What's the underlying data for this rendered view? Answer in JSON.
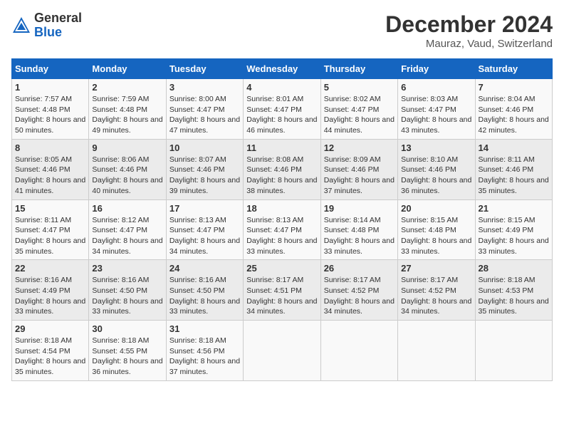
{
  "logo": {
    "text_general": "General",
    "text_blue": "Blue"
  },
  "title": "December 2024",
  "subtitle": "Mauraz, Vaud, Switzerland",
  "days_of_week": [
    "Sunday",
    "Monday",
    "Tuesday",
    "Wednesday",
    "Thursday",
    "Friday",
    "Saturday"
  ],
  "weeks": [
    [
      {
        "day": "1",
        "sunrise": "Sunrise: 7:57 AM",
        "sunset": "Sunset: 4:48 PM",
        "daylight": "Daylight: 8 hours and 50 minutes."
      },
      {
        "day": "2",
        "sunrise": "Sunrise: 7:59 AM",
        "sunset": "Sunset: 4:48 PM",
        "daylight": "Daylight: 8 hours and 49 minutes."
      },
      {
        "day": "3",
        "sunrise": "Sunrise: 8:00 AM",
        "sunset": "Sunset: 4:47 PM",
        "daylight": "Daylight: 8 hours and 47 minutes."
      },
      {
        "day": "4",
        "sunrise": "Sunrise: 8:01 AM",
        "sunset": "Sunset: 4:47 PM",
        "daylight": "Daylight: 8 hours and 46 minutes."
      },
      {
        "day": "5",
        "sunrise": "Sunrise: 8:02 AM",
        "sunset": "Sunset: 4:47 PM",
        "daylight": "Daylight: 8 hours and 44 minutes."
      },
      {
        "day": "6",
        "sunrise": "Sunrise: 8:03 AM",
        "sunset": "Sunset: 4:47 PM",
        "daylight": "Daylight: 8 hours and 43 minutes."
      },
      {
        "day": "7",
        "sunrise": "Sunrise: 8:04 AM",
        "sunset": "Sunset: 4:46 PM",
        "daylight": "Daylight: 8 hours and 42 minutes."
      }
    ],
    [
      {
        "day": "8",
        "sunrise": "Sunrise: 8:05 AM",
        "sunset": "Sunset: 4:46 PM",
        "daylight": "Daylight: 8 hours and 41 minutes."
      },
      {
        "day": "9",
        "sunrise": "Sunrise: 8:06 AM",
        "sunset": "Sunset: 4:46 PM",
        "daylight": "Daylight: 8 hours and 40 minutes."
      },
      {
        "day": "10",
        "sunrise": "Sunrise: 8:07 AM",
        "sunset": "Sunset: 4:46 PM",
        "daylight": "Daylight: 8 hours and 39 minutes."
      },
      {
        "day": "11",
        "sunrise": "Sunrise: 8:08 AM",
        "sunset": "Sunset: 4:46 PM",
        "daylight": "Daylight: 8 hours and 38 minutes."
      },
      {
        "day": "12",
        "sunrise": "Sunrise: 8:09 AM",
        "sunset": "Sunset: 4:46 PM",
        "daylight": "Daylight: 8 hours and 37 minutes."
      },
      {
        "day": "13",
        "sunrise": "Sunrise: 8:10 AM",
        "sunset": "Sunset: 4:46 PM",
        "daylight": "Daylight: 8 hours and 36 minutes."
      },
      {
        "day": "14",
        "sunrise": "Sunrise: 8:11 AM",
        "sunset": "Sunset: 4:46 PM",
        "daylight": "Daylight: 8 hours and 35 minutes."
      }
    ],
    [
      {
        "day": "15",
        "sunrise": "Sunrise: 8:11 AM",
        "sunset": "Sunset: 4:47 PM",
        "daylight": "Daylight: 8 hours and 35 minutes."
      },
      {
        "day": "16",
        "sunrise": "Sunrise: 8:12 AM",
        "sunset": "Sunset: 4:47 PM",
        "daylight": "Daylight: 8 hours and 34 minutes."
      },
      {
        "day": "17",
        "sunrise": "Sunrise: 8:13 AM",
        "sunset": "Sunset: 4:47 PM",
        "daylight": "Daylight: 8 hours and 34 minutes."
      },
      {
        "day": "18",
        "sunrise": "Sunrise: 8:13 AM",
        "sunset": "Sunset: 4:47 PM",
        "daylight": "Daylight: 8 hours and 33 minutes."
      },
      {
        "day": "19",
        "sunrise": "Sunrise: 8:14 AM",
        "sunset": "Sunset: 4:48 PM",
        "daylight": "Daylight: 8 hours and 33 minutes."
      },
      {
        "day": "20",
        "sunrise": "Sunrise: 8:15 AM",
        "sunset": "Sunset: 4:48 PM",
        "daylight": "Daylight: 8 hours and 33 minutes."
      },
      {
        "day": "21",
        "sunrise": "Sunrise: 8:15 AM",
        "sunset": "Sunset: 4:49 PM",
        "daylight": "Daylight: 8 hours and 33 minutes."
      }
    ],
    [
      {
        "day": "22",
        "sunrise": "Sunrise: 8:16 AM",
        "sunset": "Sunset: 4:49 PM",
        "daylight": "Daylight: 8 hours and 33 minutes."
      },
      {
        "day": "23",
        "sunrise": "Sunrise: 8:16 AM",
        "sunset": "Sunset: 4:50 PM",
        "daylight": "Daylight: 8 hours and 33 minutes."
      },
      {
        "day": "24",
        "sunrise": "Sunrise: 8:16 AM",
        "sunset": "Sunset: 4:50 PM",
        "daylight": "Daylight: 8 hours and 33 minutes."
      },
      {
        "day": "25",
        "sunrise": "Sunrise: 8:17 AM",
        "sunset": "Sunset: 4:51 PM",
        "daylight": "Daylight: 8 hours and 34 minutes."
      },
      {
        "day": "26",
        "sunrise": "Sunrise: 8:17 AM",
        "sunset": "Sunset: 4:52 PM",
        "daylight": "Daylight: 8 hours and 34 minutes."
      },
      {
        "day": "27",
        "sunrise": "Sunrise: 8:17 AM",
        "sunset": "Sunset: 4:52 PM",
        "daylight": "Daylight: 8 hours and 34 minutes."
      },
      {
        "day": "28",
        "sunrise": "Sunrise: 8:18 AM",
        "sunset": "Sunset: 4:53 PM",
        "daylight": "Daylight: 8 hours and 35 minutes."
      }
    ],
    [
      {
        "day": "29",
        "sunrise": "Sunrise: 8:18 AM",
        "sunset": "Sunset: 4:54 PM",
        "daylight": "Daylight: 8 hours and 35 minutes."
      },
      {
        "day": "30",
        "sunrise": "Sunrise: 8:18 AM",
        "sunset": "Sunset: 4:55 PM",
        "daylight": "Daylight: 8 hours and 36 minutes."
      },
      {
        "day": "31",
        "sunrise": "Sunrise: 8:18 AM",
        "sunset": "Sunset: 4:56 PM",
        "daylight": "Daylight: 8 hours and 37 minutes."
      },
      null,
      null,
      null,
      null
    ]
  ]
}
